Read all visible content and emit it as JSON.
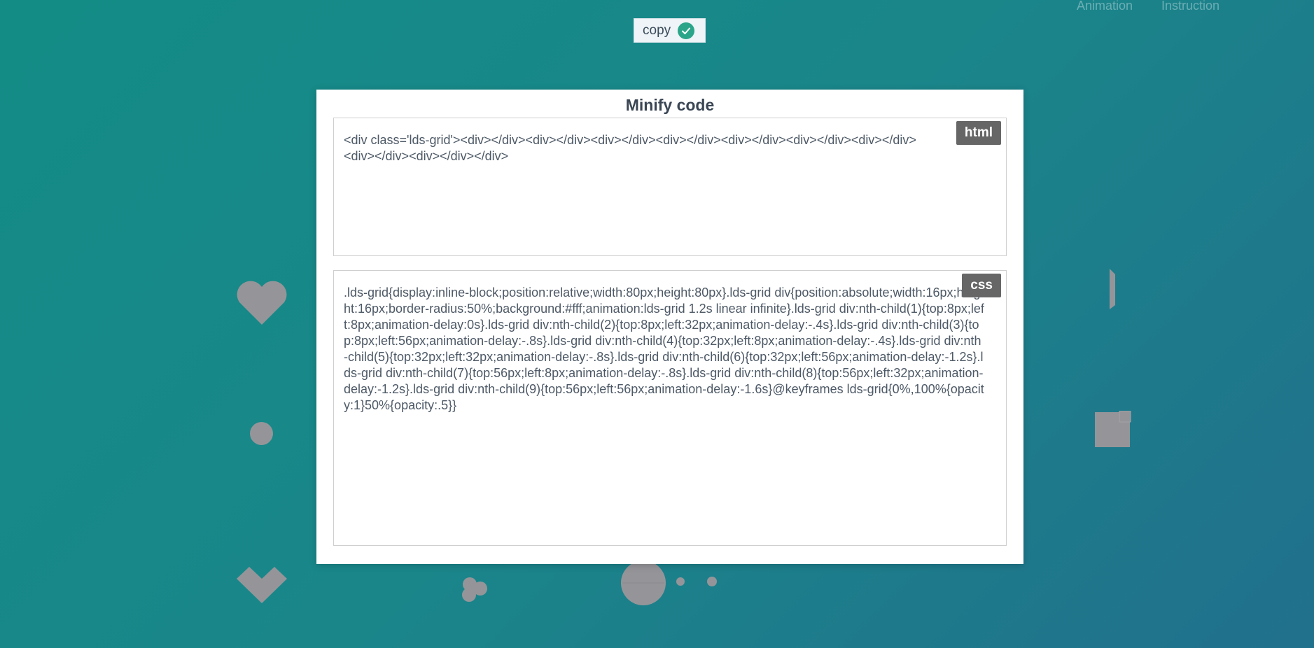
{
  "nav": {
    "animation": "Animation",
    "instruction": "Instruction"
  },
  "copy_button": {
    "label": "copy",
    "status_icon": "check-circle-icon",
    "status_color": "#2aa58a"
  },
  "modal": {
    "title": "Minify code",
    "html_panel": {
      "badge": "html",
      "lines": [
        "<div class='lds-grid'><div></div><div></div><div></div><div></div><div></div><div></div><div></div>",
        "<div></div><div></div></div>"
      ]
    },
    "css_panel": {
      "badge": "css",
      "code": ".lds-grid{display:inline-block;position:relative;width:80px;height:80px}.lds-grid div{position:absolute;width:16px;height:16px;border-radius:50%;background:#fff;animation:lds-grid 1.2s linear infinite}.lds-grid div:nth-child(1){top:8px;left:8px;animation-delay:0s}.lds-grid div:nth-child(2){top:8px;left:32px;animation-delay:-.4s}.lds-grid div:nth-child(3){top:8px;left:56px;animation-delay:-.8s}.lds-grid div:nth-child(4){top:32px;left:8px;animation-delay:-.4s}.lds-grid div:nth-child(5){top:32px;left:32px;animation-delay:-.8s}.lds-grid div:nth-child(6){top:32px;left:56px;animation-delay:-1.2s}.lds-grid div:nth-child(7){top:56px;left:8px;animation-delay:-.8s}.lds-grid div:nth-child(8){top:56px;left:32px;animation-delay:-1.2s}.lds-grid div:nth-child(9){top:56px;left:56px;animation-delay:-1.6s}@keyframes lds-grid{0%,100%{opacity:1}50%{opacity:.5}}"
    }
  },
  "decorations": {
    "icons": [
      "heart-icon",
      "circle-icon",
      "heart-icon",
      "dots-icon",
      "bouncing-balls-icon",
      "half-shape-icon",
      "square-icon"
    ],
    "color": "#959599"
  }
}
